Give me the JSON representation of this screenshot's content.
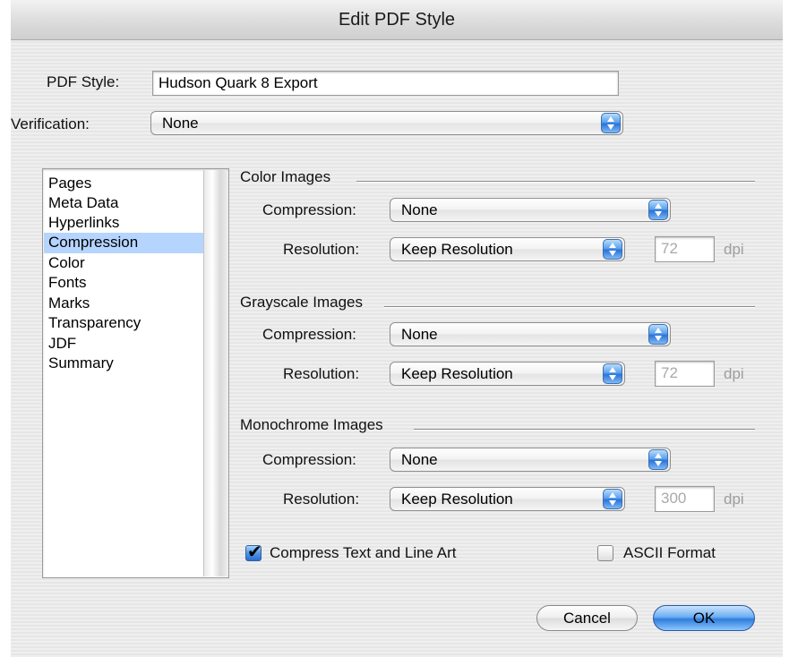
{
  "window": {
    "title": "Edit PDF Style"
  },
  "form": {
    "pdf_style_label": "PDF Style:",
    "pdf_style_value": "Hudson Quark 8 Export",
    "verification_label": "Verification:",
    "verification_value": "None"
  },
  "sidebar": {
    "items": [
      {
        "label": "Pages",
        "selected": false
      },
      {
        "label": "Meta Data",
        "selected": false
      },
      {
        "label": "Hyperlinks",
        "selected": false
      },
      {
        "label": "Compression",
        "selected": true
      },
      {
        "label": "Color",
        "selected": false
      },
      {
        "label": "Fonts",
        "selected": false
      },
      {
        "label": "Marks",
        "selected": false
      },
      {
        "label": "Transparency",
        "selected": false
      },
      {
        "label": "JDF",
        "selected": false
      },
      {
        "label": "Summary",
        "selected": false
      }
    ]
  },
  "sections": {
    "color": {
      "title": "Color Images",
      "compression_label": "Compression:",
      "compression_value": "None",
      "resolution_label": "Resolution:",
      "resolution_value": "Keep Resolution",
      "dpi_value": "72",
      "dpi_unit": "dpi"
    },
    "grayscale": {
      "title": "Grayscale Images",
      "compression_label": "Compression:",
      "compression_value": "None",
      "resolution_label": "Resolution:",
      "resolution_value": "Keep Resolution",
      "dpi_value": "72",
      "dpi_unit": "dpi"
    },
    "monochrome": {
      "title": "Monochrome Images",
      "compression_label": "Compression:",
      "compression_value": "None",
      "resolution_label": "Resolution:",
      "resolution_value": "Keep Resolution",
      "dpi_value": "300",
      "dpi_unit": "dpi"
    }
  },
  "options": {
    "compress_text_label": "Compress Text and Line Art",
    "compress_text_checked": true,
    "ascii_label": "ASCII Format",
    "ascii_checked": false
  },
  "buttons": {
    "cancel": "Cancel",
    "ok": "OK"
  },
  "colors": {
    "selection": "#b5d5ff",
    "accent": "#2f7ddb"
  }
}
